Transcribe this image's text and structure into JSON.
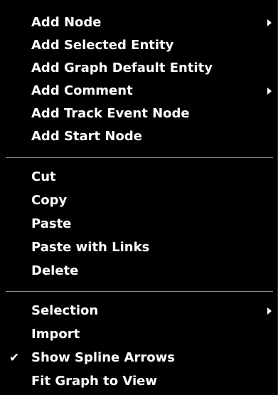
{
  "menu": {
    "groups": [
      {
        "items": [
          {
            "label": "Add Node",
            "submenu": true
          },
          {
            "label": "Add Selected Entity"
          },
          {
            "label": "Add Graph Default Entity"
          },
          {
            "label": "Add Comment",
            "submenu": true
          },
          {
            "label": "Add Track Event Node"
          },
          {
            "label": "Add Start Node"
          }
        ]
      },
      {
        "items": [
          {
            "label": "Cut"
          },
          {
            "label": "Copy"
          },
          {
            "label": "Paste"
          },
          {
            "label": "Paste with Links"
          },
          {
            "label": "Delete"
          }
        ]
      },
      {
        "items": [
          {
            "label": "Selection",
            "submenu": true
          },
          {
            "label": "Import"
          },
          {
            "label": "Show Spline Arrows",
            "checked": true,
            "check_glyph": "✔"
          },
          {
            "label": "Fit Graph to View"
          }
        ]
      }
    ]
  },
  "colors": {
    "background": "#000000",
    "text": "#ffffff",
    "separator": "#8a8a8a"
  }
}
